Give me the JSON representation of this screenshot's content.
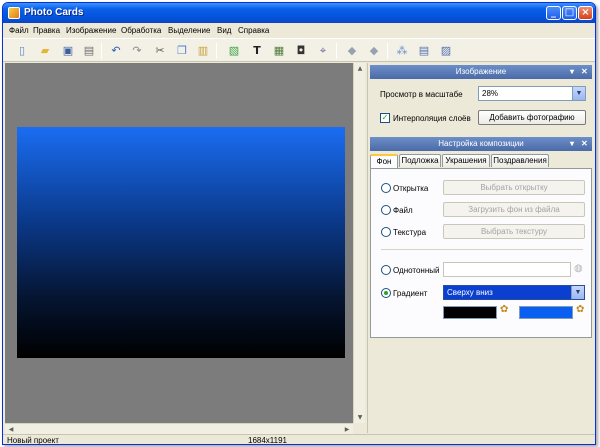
{
  "window": {
    "title": "Photo Cards"
  },
  "menu": [
    "Файл",
    "Правка",
    "Изображение",
    "Обработка",
    "Выделение",
    "Вид",
    "Справка"
  ],
  "toolbar_icons": [
    "new-file-icon",
    "open-folder-icon",
    "save-icon",
    "print-icon",
    "undo-icon",
    "redo-icon",
    "cut-icon",
    "copy-icon",
    "paste-icon",
    "add-image-icon",
    "text-icon",
    "photo-frame-icon",
    "frame-icon",
    "crop-icon",
    "move-back-icon",
    "move-forward-icon",
    "effects-icon",
    "page-icon",
    "export-icon"
  ],
  "image_panel": {
    "title": "Изображение",
    "zoom_label": "Просмотр в масштабе",
    "zoom_value": "28%",
    "interp_label": "Интерполяция слоёв",
    "add_photo": "Добавить фотографию"
  },
  "composition_panel": {
    "title": "Настройка композиции",
    "tabs": [
      "Фон",
      "Подложка",
      "Украшения",
      "Поздравления"
    ],
    "opt_card": "Открытка",
    "btn_card": "Выбрать открытку",
    "opt_file": "Файл",
    "btn_file": "Загрузить фон из файла",
    "opt_texture": "Текстура",
    "btn_texture": "Выбрать текстуру",
    "opt_solid": "Однотонный",
    "opt_gradient": "Градиент",
    "gradient_value": "Сверху вниз",
    "color1": "#000000",
    "color2": "#0b5ff0"
  },
  "preview": {
    "gradient_top": "#1a6df2",
    "gradient_bottom": "#000000"
  },
  "status": {
    "left": "Новый проект",
    "size": "1684x1191"
  }
}
